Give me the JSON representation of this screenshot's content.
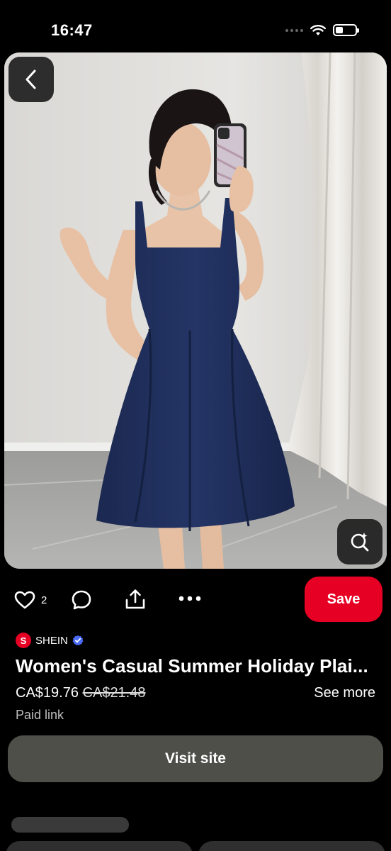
{
  "status_bar": {
    "time": "16:47",
    "icons": [
      "signal-dots-icon",
      "wifi-icon",
      "battery-icon"
    ]
  },
  "pin": {
    "image_description_icon": "dress-photo",
    "back_icon": "chevron-left-icon",
    "visual_search_icon": "lens-search-icon"
  },
  "actions": {
    "like_icon": "heart-icon",
    "like_count": "2",
    "comment_icon": "comment-icon",
    "share_icon": "share-icon",
    "more_icon": "more-dots-icon",
    "save_label": "Save"
  },
  "product": {
    "brand_initial": "S",
    "brand_name": "SHEIN",
    "title": "Women's Casual Summer Holiday Plai...",
    "price": "CA$19.76",
    "original_price": "CA$21.48",
    "see_more_label": "See more",
    "paid_link_label": "Paid link",
    "visit_label": "Visit site"
  },
  "colors": {
    "background": "#000000",
    "save_red": "#e60023",
    "visit_gray": "#4f4f4a",
    "dress_navy": "#1f2d5c",
    "verified_blue": "#4a6cf7"
  }
}
